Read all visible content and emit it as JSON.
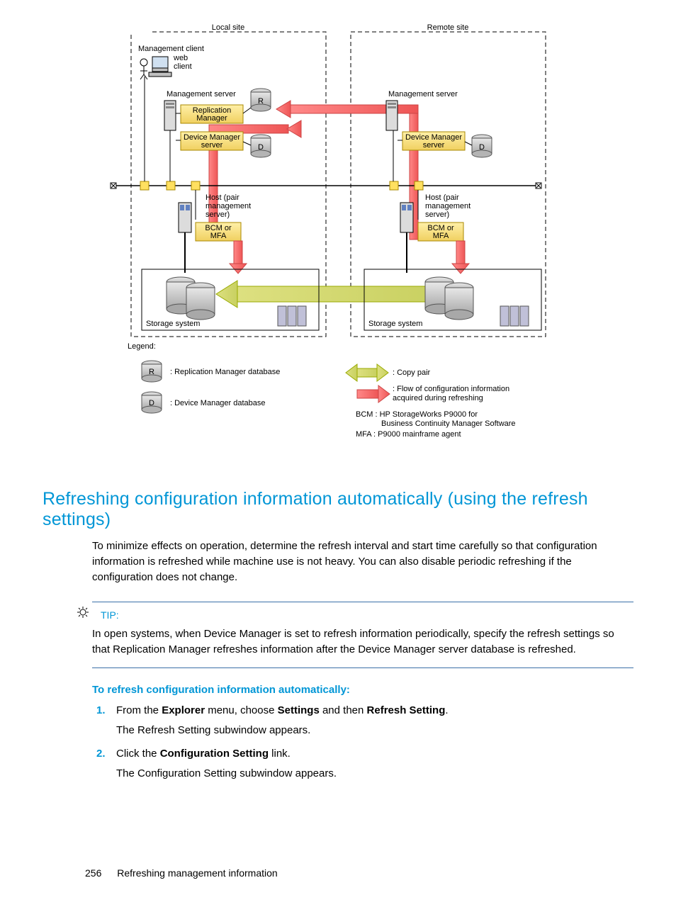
{
  "diagram": {
    "local_site": "Local site",
    "remote_site": "Remote site",
    "management_client": "Management client",
    "web_client_l1": "web",
    "web_client_l2": "client",
    "management_server": "Management server",
    "replication_manager_l1": "Replication",
    "replication_manager_l2": "Manager",
    "device_manager_server_l1": "Device Manager",
    "device_manager_server_l2": "server",
    "host_l1": "Host (pair",
    "host_l2": "management",
    "host_l3": "server)",
    "bcm_l1": "BCM or",
    "bcm_l2": "MFA",
    "storage_system": "Storage system",
    "legend": "Legend:",
    "letter_R": "R",
    "letter_D": "D",
    "r_desc": ": Replication Manager database",
    "d_desc": ": Device Manager database",
    "copy_pair": ": Copy pair",
    "flow_l1": ": Flow of configuration information",
    "flow_l2": "  acquired during refreshing",
    "bcm_def_l1": "BCM : HP StorageWorks P9000 for",
    "bcm_def_l2": "Business Continuity Manager Software",
    "mfa_def": "MFA :  P9000 mainframe agent"
  },
  "heading": "Refreshing configuration information automatically (using the refresh settings)",
  "intro": "To minimize effects on operation, determine the refresh interval and start time carefully so that configuration information is refreshed while machine use is not heavy. You can also disable periodic refreshing if the configuration does not change.",
  "tip_label": "TIP:",
  "tip_text": "In open systems, when Device Manager is set to refresh information periodically, specify the refresh settings so that Replication Manager refreshes information after the Device Manager server database is refreshed.",
  "subhead": "To refresh configuration information automatically:",
  "step1_pre": "From the ",
  "step1_b1": "Explorer",
  "step1_mid1": " menu, choose ",
  "step1_b2": "Settings",
  "step1_mid2": " and then ",
  "step1_b3": "Refresh Setting",
  "step1_post": ".",
  "step1_sub": "The Refresh Setting subwindow appears.",
  "step2_pre": "Click the ",
  "step2_b1": "Configuration Setting",
  "step2_post": " link.",
  "step2_sub": "The Configuration Setting subwindow appears.",
  "page_number": "256",
  "footer_title": "Refreshing management information"
}
